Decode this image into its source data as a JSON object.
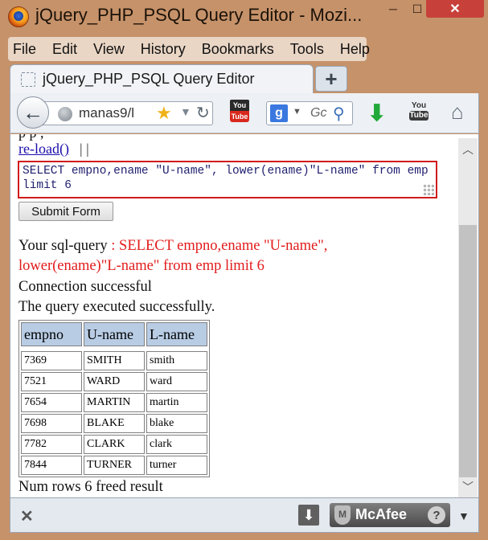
{
  "window": {
    "title": "jQuery_PHP_PSQL Query Editor - Mozi...",
    "minimize": "─",
    "maximize": "☐",
    "close": "✕"
  },
  "menu": {
    "items": [
      "File",
      "Edit",
      "View",
      "History",
      "Bookmarks",
      "Tools",
      "Help"
    ]
  },
  "tab": {
    "label": "jQuery_PHP_PSQL Query Editor",
    "new_tab": "+"
  },
  "nav": {
    "url": "manas9/l",
    "search_text": "Gc",
    "yt_top": "You",
    "yt_bot": "Tube",
    "yt2_top": "You",
    "yt2_bot": "Tube"
  },
  "page": {
    "cut_text": "p                  p     ,",
    "reload_link": "re-load()",
    "reload_sep": "| |",
    "query": "SELECT empno,ename \"U-name\", lower(ename)\"L-name\" from emp limit 6",
    "submit_label": "Submit Form",
    "sql_label": "Your sql-query",
    "sql_value_line1": ": SELECT empno,ename \"U-name\",",
    "sql_value_line2": "lower(ename)\"L-name\" from emp limit 6",
    "connection": "Connection successful",
    "executed": "The query executed successfully.",
    "footer": "Num rows 6 freed result"
  },
  "table": {
    "headers": [
      "empno",
      "U-name",
      "L-name"
    ],
    "rows": [
      [
        "7369",
        "SMITH",
        "smith"
      ],
      [
        "7521",
        "WARD",
        "ward"
      ],
      [
        "7654",
        "MARTIN",
        "martin"
      ],
      [
        "7698",
        "BLAKE",
        "blake"
      ],
      [
        "7782",
        "CLARK",
        "clark"
      ],
      [
        "7844",
        "TURNER",
        "turner"
      ]
    ]
  },
  "addon": {
    "close": "✕",
    "mcafee": "McAfee",
    "help": "?"
  },
  "colors": {
    "frame": "#c6926a",
    "accent_red": "#e21b1b",
    "header_blue": "#b8cce4",
    "link": "#1a0dab"
  }
}
